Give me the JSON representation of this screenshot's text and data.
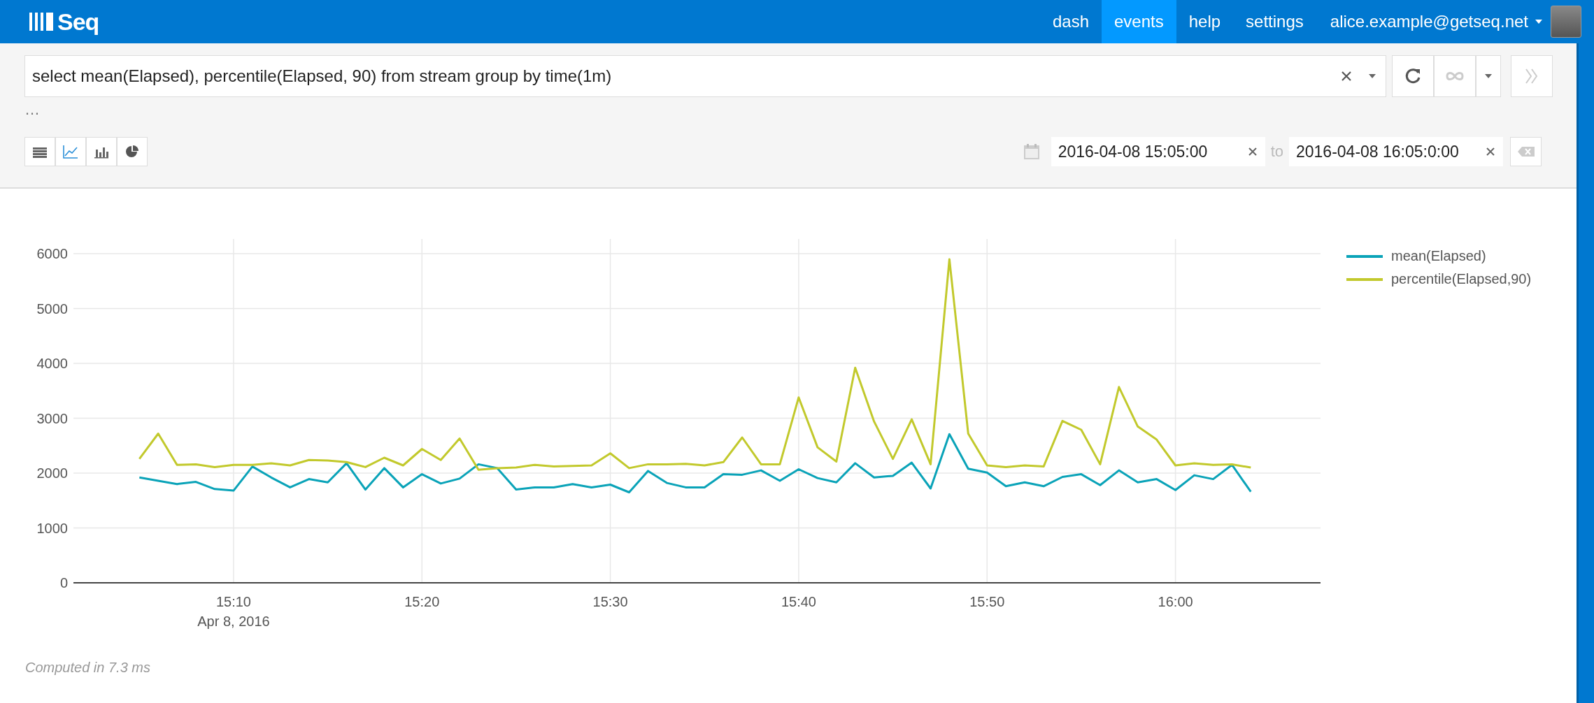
{
  "header": {
    "logo": "Seq",
    "nav": [
      {
        "label": "dash",
        "selected": false
      },
      {
        "label": "events",
        "selected": true
      },
      {
        "label": "help",
        "selected": false
      },
      {
        "label": "settings",
        "selected": false
      }
    ],
    "user": "alice.example@getseq.net"
  },
  "query": {
    "value": "select mean(Elapsed), percentile(Elapsed, 90) from stream group by time(1m)",
    "more": "…"
  },
  "views": [
    {
      "kind": "table",
      "selected": false
    },
    {
      "kind": "line",
      "selected": true
    },
    {
      "kind": "bar",
      "selected": false
    },
    {
      "kind": "pie",
      "selected": false
    }
  ],
  "range": {
    "from": "2016-04-08 15:05:00",
    "to_label": "to",
    "to": "2016-04-08 16:05:0:00"
  },
  "chart": {
    "date_label": "Apr 8, 2016",
    "chart_data": {
      "type": "line",
      "categories": [
        null,
        null,
        null,
        null,
        null,
        "15:10",
        null,
        null,
        null,
        null,
        null,
        null,
        null,
        null,
        null,
        "15:20",
        null,
        null,
        null,
        null,
        null,
        null,
        null,
        null,
        null,
        "15:30",
        null,
        null,
        null,
        null,
        null,
        null,
        null,
        null,
        null,
        "15:40",
        null,
        null,
        null,
        null,
        null,
        null,
        null,
        null,
        null,
        "15:50",
        null,
        null,
        null,
        null,
        null,
        null,
        null,
        null,
        null,
        "16:00",
        null,
        null,
        null,
        null
      ],
      "series": [
        {
          "name": "mean(Elapsed)",
          "color": "#0aa3b8",
          "values": [
            1920,
            1860,
            1800,
            1840,
            1710,
            1680,
            2120,
            1920,
            1740,
            1890,
            1830,
            2180,
            1700,
            2090,
            1740,
            1980,
            1810,
            1900,
            2160,
            2090,
            1700,
            1740,
            1740,
            1800,
            1740,
            1790,
            1650,
            2040,
            1820,
            1740,
            1740,
            1980,
            1970,
            2050,
            1860,
            2070,
            1910,
            1830,
            2180,
            1920,
            1950,
            2190,
            1720,
            2710,
            2080,
            2010,
            1760,
            1830,
            1760,
            1930,
            1980,
            1780,
            2050,
            1830,
            1890,
            1690,
            1960,
            1890,
            2150,
            1660
          ]
        },
        {
          "name": "percentile(Elapsed,90)",
          "color": "#c2c92c",
          "values": [
            2260,
            2720,
            2150,
            2160,
            2110,
            2150,
            2150,
            2180,
            2140,
            2240,
            2230,
            2200,
            2110,
            2280,
            2140,
            2440,
            2240,
            2630,
            2060,
            2090,
            2100,
            2150,
            2120,
            2130,
            2140,
            2360,
            2090,
            2160,
            2160,
            2170,
            2140,
            2200,
            2650,
            2160,
            2160,
            3380,
            2470,
            2210,
            3920,
            2940,
            2260,
            2980,
            2160,
            5900,
            2720,
            2140,
            2110,
            2140,
            2120,
            2950,
            2790,
            2160,
            3570,
            2850,
            2610,
            2140,
            2180,
            2150,
            2160,
            2100
          ]
        }
      ],
      "ylim": [
        0,
        6000
      ],
      "grid": true,
      "legend": "right",
      "yticks": [
        0,
        1000,
        2000,
        3000,
        4000,
        5000,
        6000
      ]
    }
  },
  "status": "Computed in 7.3 ms"
}
